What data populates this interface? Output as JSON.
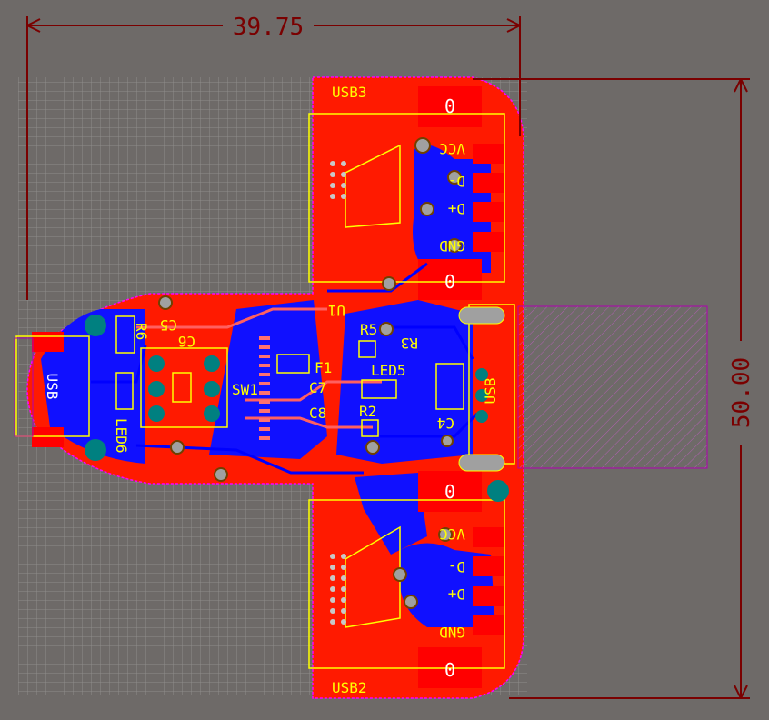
{
  "dimensions": {
    "width_label": "39.75",
    "height_label": "50.00"
  },
  "connectors": {
    "usb3": "USB3",
    "usb2": "USB2",
    "usb": "USB",
    "usb_left": "USB"
  },
  "pins_top": {
    "vcc": "VCC",
    "dminus": "D-",
    "dplus": "D+",
    "gnd": "GND"
  },
  "pins_bottom": {
    "vcc": "VCC",
    "dminus": "D-",
    "dplus": "D+",
    "gnd": "GND"
  },
  "pad_labels": {
    "p1": "0",
    "p2": "0",
    "p3": "0",
    "p4": "0"
  },
  "components": {
    "u1": "U1",
    "r5": "R5",
    "r6": "R6",
    "r2": "R2",
    "f1": "F1",
    "c7": "C7",
    "c8": "C8",
    "sw1": "SW1",
    "led5": "LED5",
    "led6": "LED6",
    "r3": "R3",
    "c5": "C5",
    "c6": "C6",
    "c4": "C4"
  },
  "colors": {
    "background": "#6e6a68",
    "top_copper": "#ff0000",
    "bottom_copper": "#0000ff",
    "silkscreen": "#ffff00",
    "outline": "#ff00ff",
    "dimension": "#7a0000",
    "pad": "#008080"
  }
}
